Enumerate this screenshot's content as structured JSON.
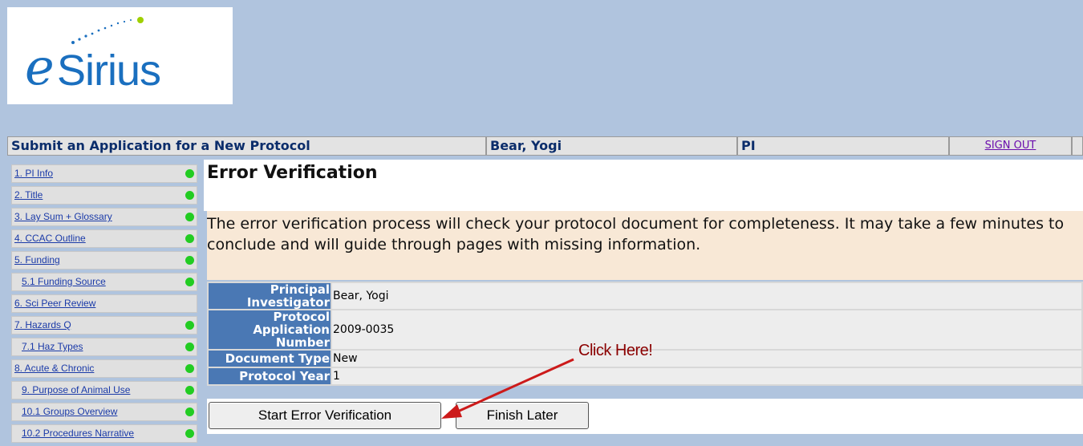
{
  "logo": {
    "text_e": "e",
    "text_rest": "Sirius"
  },
  "header": {
    "title": "Submit an Application for a New Protocol",
    "user": "Bear, Yogi",
    "role": "PI",
    "signout": "SIGN OUT"
  },
  "sidebar": {
    "items": [
      {
        "label": "1. PI Info",
        "status": "green"
      },
      {
        "label": "2. Title",
        "status": "green"
      },
      {
        "label": "3. Lay Sum + Glossary",
        "status": "green"
      },
      {
        "label": "4. CCAC Outline",
        "status": "green"
      },
      {
        "label": "5. Funding",
        "status": "green"
      },
      {
        "label": "5.1 Funding Source",
        "status": "green"
      },
      {
        "label": "6. Sci Peer Review",
        "status": "none"
      },
      {
        "label": "7. Hazards Q",
        "status": "green"
      },
      {
        "label": "7.1 Haz Types",
        "status": "green"
      },
      {
        "label": "8. Acute & Chronic",
        "status": "green"
      },
      {
        "label": "9. Purpose of Animal Use",
        "status": "green"
      },
      {
        "label": "10.1 Groups Overview",
        "status": "green"
      },
      {
        "label": "10.2 Procedures Narrative",
        "status": "green"
      }
    ]
  },
  "main": {
    "title": "Error Verification",
    "description": "The error verification process will check your protocol document for completeness. It may take a few minutes to conclude and will guide through pages with missing information.",
    "info": [
      {
        "label": "Principal Investigator",
        "value": "Bear, Yogi"
      },
      {
        "label": "Protocol Application Number",
        "value": "2009-0035"
      },
      {
        "label": "Document Type",
        "value": "New"
      },
      {
        "label": "Protocol Year",
        "value": "1"
      }
    ],
    "start_button": "Start Error Verification",
    "finish_button": "Finish Later"
  },
  "annotation": {
    "text": "Click Here!"
  },
  "colors": {
    "background": "#b0c4de",
    "label_bg": "#4a78b4",
    "status_green": "#22cc22",
    "arrow": "#cc1a1a"
  }
}
